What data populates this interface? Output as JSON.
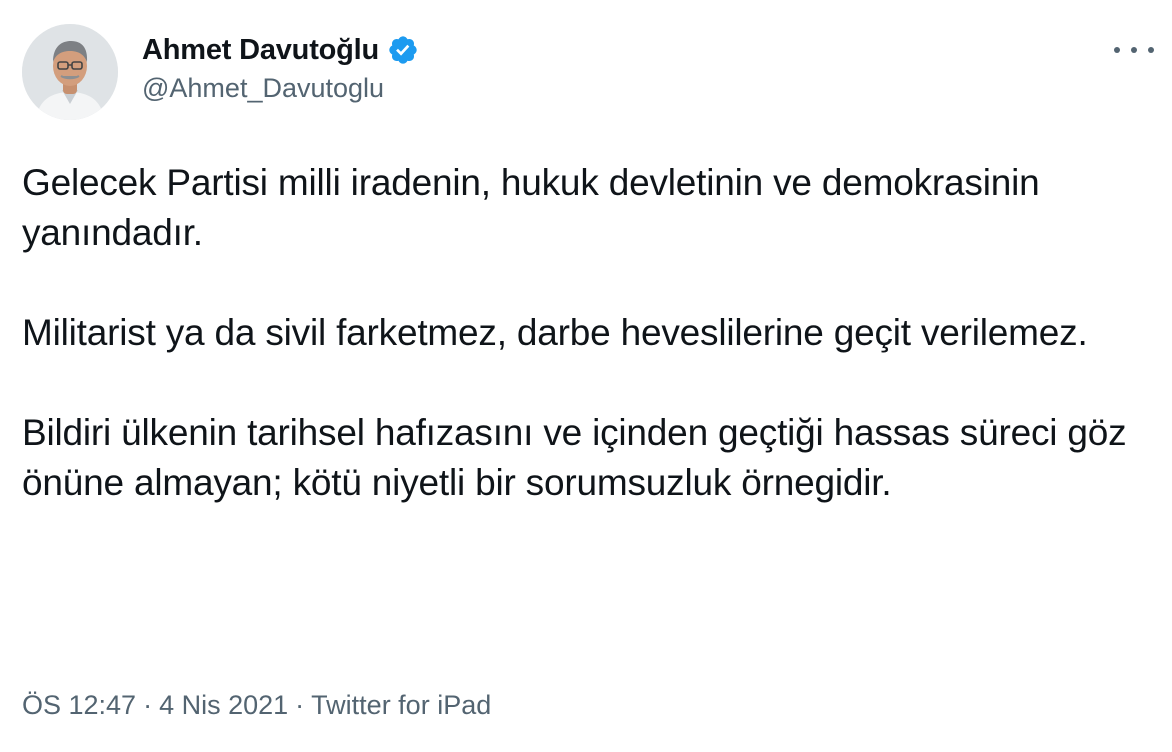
{
  "author": {
    "display_name": "Ahmet Davutoğlu",
    "handle": "@Ahmet_Davutoglu",
    "verified_icon": "verified-badge-icon",
    "more_icon": "more-options-icon"
  },
  "tweet": {
    "paragraphs": [
      "Gelecek Partisi milli iradenin, hukuk devletinin ve demokrasinin yanındadır.",
      "Militarist ya da sivil farketmez, darbe heveslilerine geçit verilemez.",
      "Bildiri ülkenin tarihsel hafızasını ve içinden geçtiği hassas süreci göz önüne almayan; kötü niyetli bir sorumsuzluk örnegidir."
    ]
  },
  "meta": {
    "time": "ÖS 12:47",
    "date": "4 Nis 2021",
    "source": "Twitter for iPad",
    "separator": "·"
  },
  "colors": {
    "text": "#0f1419",
    "secondary": "#536471",
    "verified": "#1d9bf0"
  }
}
